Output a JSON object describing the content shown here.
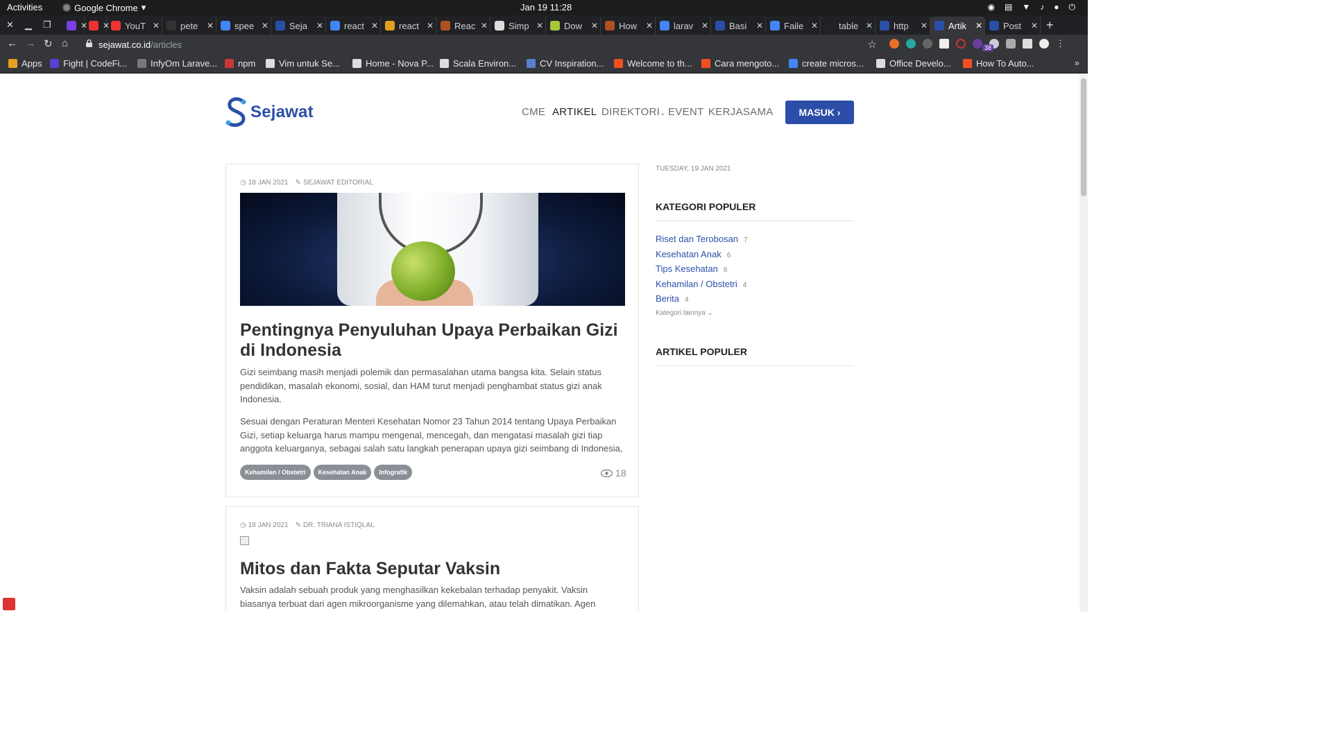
{
  "system": {
    "activities": "Activities",
    "app_name": "Google Chrome",
    "clock": "Jan 19  11:28"
  },
  "tabs": [
    {
      "label": "",
      "color": "#7b3fe4"
    },
    {
      "label": "",
      "color": "#e33"
    },
    {
      "label": "YouT",
      "color": "#e33"
    },
    {
      "label": "pete",
      "color": "#333"
    },
    {
      "label": "spee",
      "color": "#4285f4"
    },
    {
      "label": "Seja",
      "color": "#2b4fa8"
    },
    {
      "label": "react",
      "color": "#4285f4"
    },
    {
      "label": "react",
      "color": "#e0a020"
    },
    {
      "label": "Reac",
      "color": "#b05020"
    },
    {
      "label": "Simp",
      "color": "#ddd"
    },
    {
      "label": "Dow",
      "color": "#a4c639"
    },
    {
      "label": "How",
      "color": "#b05020"
    },
    {
      "label": "larav",
      "color": "#4285f4"
    },
    {
      "label": "Basi",
      "color": "#2b4fa8"
    },
    {
      "label": "Faile",
      "color": "#4285f4"
    },
    {
      "label": "table",
      "color": "#222"
    },
    {
      "label": "http",
      "color": "#2b4fa8"
    },
    {
      "label": "Artik",
      "color": "#2b4fa8",
      "active": true
    },
    {
      "label": "Post",
      "color": "#2b4fa8"
    }
  ],
  "address": {
    "host": "sejawat.co.id",
    "path": "/articles"
  },
  "bookmarks": [
    {
      "label": "Apps",
      "color": "#e8a020"
    },
    {
      "label": "Fight | CodeFi...",
      "color": "#5b3fd0"
    },
    {
      "label": "InfyOm Larave...",
      "color": "#777"
    },
    {
      "label": "npm",
      "color": "#cb3837"
    },
    {
      "label": "Vim untuk Se...",
      "color": "#ddd"
    },
    {
      "label": "Home - Nova P...",
      "color": "#ddd"
    },
    {
      "label": "Scala Environ...",
      "color": "#ddd"
    },
    {
      "label": "CV Inspiration...",
      "color": "#5b7fd0"
    },
    {
      "label": "Welcome to th...",
      "color": "#f25022"
    },
    {
      "label": "Cara mengoto...",
      "color": "#f25022"
    },
    {
      "label": "create micros...",
      "color": "#4285f4"
    },
    {
      "label": "Office Develo...",
      "color": "#ddd"
    },
    {
      "label": "How To Auto...",
      "color": "#f25022"
    }
  ],
  "site": {
    "brand": "Sejawat",
    "nav": [
      "CME",
      "ARTIKEL",
      "DIREKTORI",
      "EVENT",
      "KERJASAMA"
    ],
    "login": "MASUK ›"
  },
  "articles": [
    {
      "date": "18 JAN 2021",
      "author": "SEJAWAT EDITORIAL",
      "title": "Pentingnya Penyuluhan Upaya Perbaikan Gizi di Indonesia",
      "p1": "Gizi seimbang masih menjadi polemik dan permasalahan utama bangsa kita. Selain status pendidikan, masalah ekonomi, sosial, dan HAM turut menjadi penghambat status gizi anak Indonesia.",
      "p2": "Sesuai dengan Peraturan Menteri Kesehatan Nomor 23 Tahun 2014 tentang Upaya Perbaikan Gizi, setiap keluarga harus mampu mengenal, mencegah, dan mengatasi masalah gizi tiap anggota keluarganya, sebagai salah satu langkah penerapan upaya gizi seimbang di Indonesia,",
      "tags": [
        "Kehamilan / Obstetri",
        "Kesehatan Anak",
        "Infografik"
      ],
      "views": "18"
    },
    {
      "date": "18 JAN 2021",
      "author": "DR. TRIANA ISTIQLAL",
      "title": "Mitos dan Fakta Seputar Vaksin",
      "p1": "Vaksin adalah sebuah produk yang menghasilkan kekebalan terhadap penyakit. Vaksin biasanya terbuat dari agen mikroorganisme yang dilemahkan, atau telah dimatikan. Agen tersebut akan"
    }
  ],
  "sidebar": {
    "date": "TUESDAY, 19 JAN 2021",
    "categories_title": "KATEGORI POPULER",
    "categories": [
      {
        "label": "Riset dan Terobosan",
        "count": "7"
      },
      {
        "label": "Kesehatan Anak",
        "count": "6"
      },
      {
        "label": "Tips Kesehatan",
        "count": "6"
      },
      {
        "label": "Kehamilan / Obstetri",
        "count": "4"
      },
      {
        "label": "Berita",
        "count": "4"
      }
    ],
    "more": "Kategori lainnya ⌄",
    "popular_title": "ARTIKEL POPULER"
  },
  "colors": {
    "brand": "#2c4ea9"
  }
}
